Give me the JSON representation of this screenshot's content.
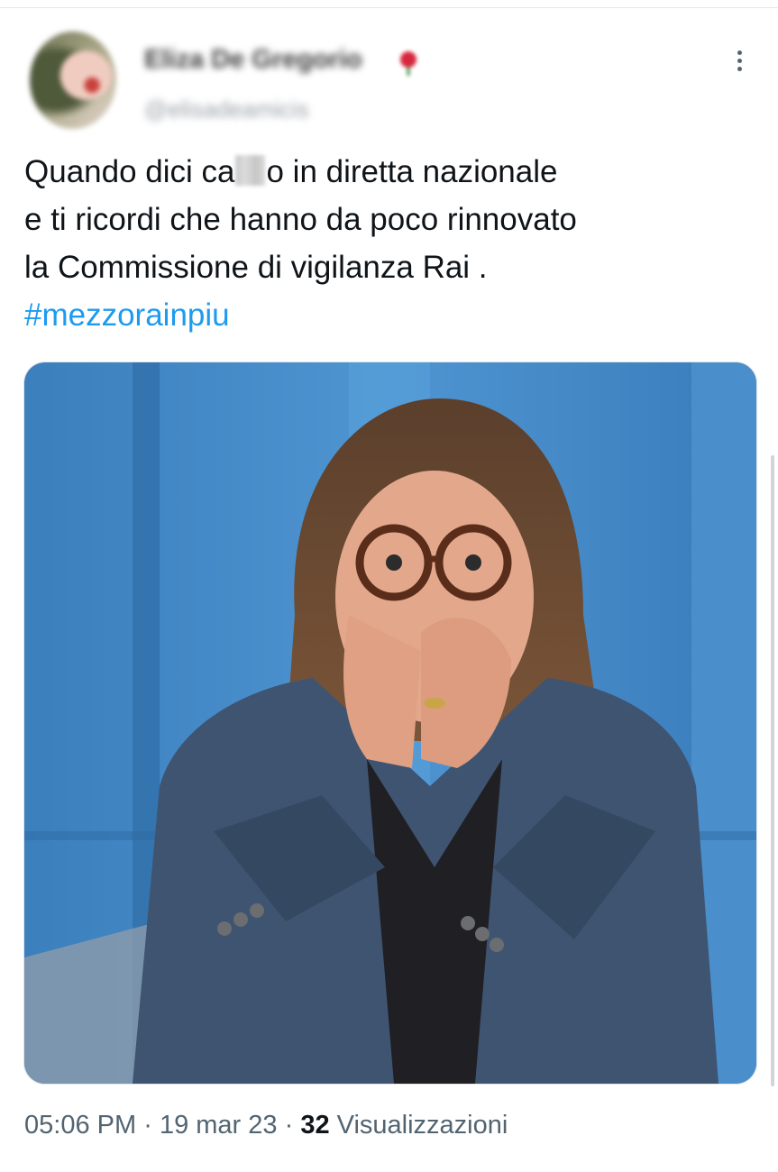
{
  "tweet": {
    "author": {
      "display_name": "Eliza De Gregorio",
      "handle": "@elisadeamicis"
    },
    "text": {
      "line1_before": "Quando dici ca",
      "line1_after": "o in diretta nazionale",
      "line2": "e ti ricordi che hanno da poco rinnovato",
      "line3": "la Commissione di vigilanza Rai .",
      "hashtag": "#mezzorainpiu"
    },
    "meta": {
      "time": "05:06 PM",
      "separator": "·",
      "date": "19 mar 23",
      "views_count": "32",
      "views_label": "Visualizzazioni"
    }
  },
  "colors": {
    "text": "#0f1419",
    "secondary": "#536471",
    "link": "#1d9bf0",
    "studio_blue": "#3f83c3",
    "jacket": "#3f5470"
  },
  "icons": {
    "more": "more-vertical-icon",
    "rose": "rose-emoji-icon"
  }
}
